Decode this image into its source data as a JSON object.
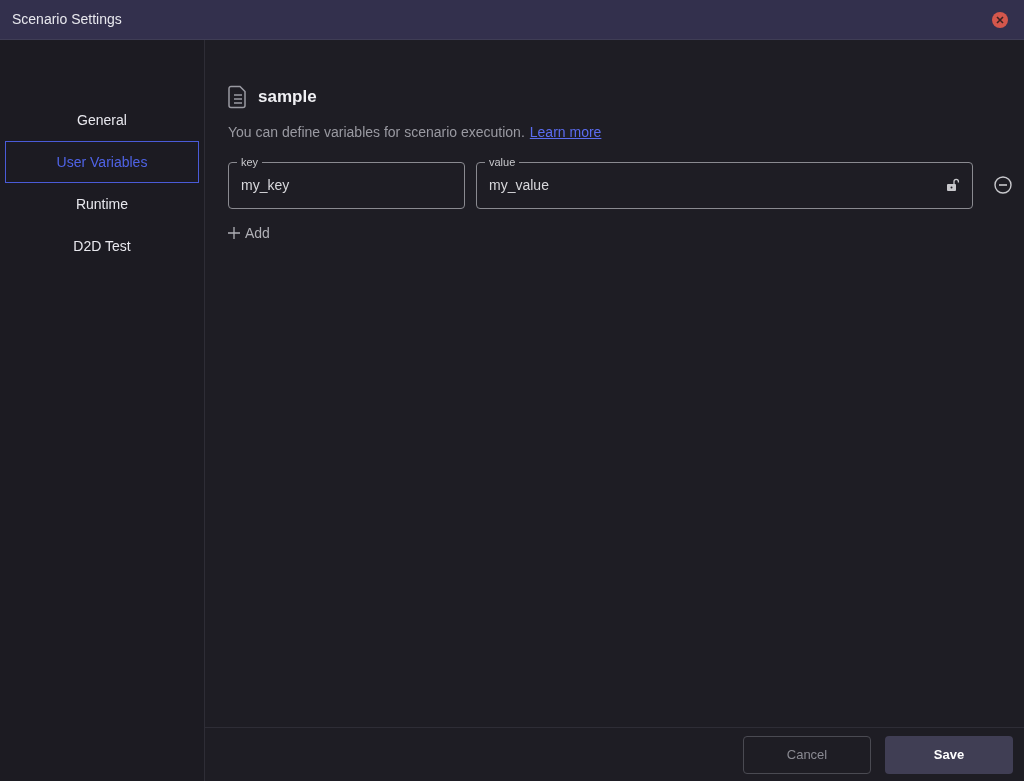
{
  "window": {
    "title": "Scenario Settings"
  },
  "sidebar": {
    "items": [
      {
        "label": "General",
        "selected": false
      },
      {
        "label": "User Variables",
        "selected": true
      },
      {
        "label": "Runtime",
        "selected": false
      },
      {
        "label": "D2D Test",
        "selected": false
      }
    ]
  },
  "content": {
    "title": "sample",
    "description": "You can define variables for scenario execution.",
    "link": "Learn more",
    "variables": [
      {
        "key_label": "key",
        "key": "my_key",
        "value_label": "value",
        "value": "my_value"
      }
    ],
    "add_label": "Add"
  },
  "footer": {
    "buttons": [
      {
        "label": "Cancel",
        "kind": "secondary"
      },
      {
        "label": "Save",
        "kind": "primary"
      }
    ]
  }
}
